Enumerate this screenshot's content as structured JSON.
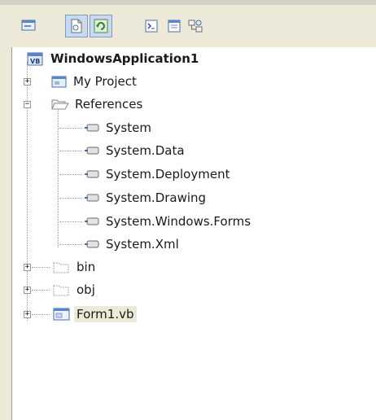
{
  "toolbar": {
    "buttons": [
      {
        "name": "properties-icon"
      },
      {
        "name": "show-all-files-icon"
      },
      {
        "name": "refresh-icon"
      },
      {
        "name": "view-code-icon"
      },
      {
        "name": "view-designer-icon"
      },
      {
        "name": "class-diagram-icon"
      }
    ]
  },
  "tree": {
    "project": "WindowsApplication1",
    "my_project": "My Project",
    "references": "References",
    "ref_items": [
      "System",
      "System.Data",
      "System.Deployment",
      "System.Drawing",
      "System.Windows.Forms",
      "System.Xml"
    ],
    "bin": "bin",
    "obj": "obj",
    "form": "Form1.vb"
  },
  "colors": {
    "background": "#ece9d8",
    "tree_background": "#ffffff",
    "selection": "#c9d9ef"
  }
}
